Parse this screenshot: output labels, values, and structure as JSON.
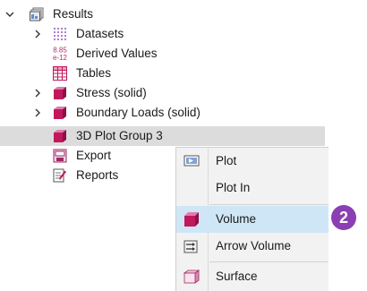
{
  "tree": {
    "root": {
      "label": "Results"
    },
    "items": [
      {
        "label": "Datasets"
      },
      {
        "label": "Derived Values",
        "icon_text": "8.85\ne-12"
      },
      {
        "label": "Tables"
      },
      {
        "label": "Stress (solid)"
      },
      {
        "label": "Boundary Loads (solid)"
      },
      {
        "label": "3D Plot Group 3"
      },
      {
        "label": "Export"
      },
      {
        "label": "Reports"
      }
    ]
  },
  "context_menu": {
    "items": [
      {
        "label": "Plot"
      },
      {
        "label": "Plot In"
      },
      {
        "label": "Volume"
      },
      {
        "label": "Arrow Volume"
      },
      {
        "label": "Surface"
      }
    ]
  },
  "badge": {
    "text": "2",
    "color": "#8a3fb2"
  },
  "colors": {
    "plot_icon": "#c2185b",
    "selection": "#dcdcdc",
    "highlight": "#cfe6f7"
  }
}
